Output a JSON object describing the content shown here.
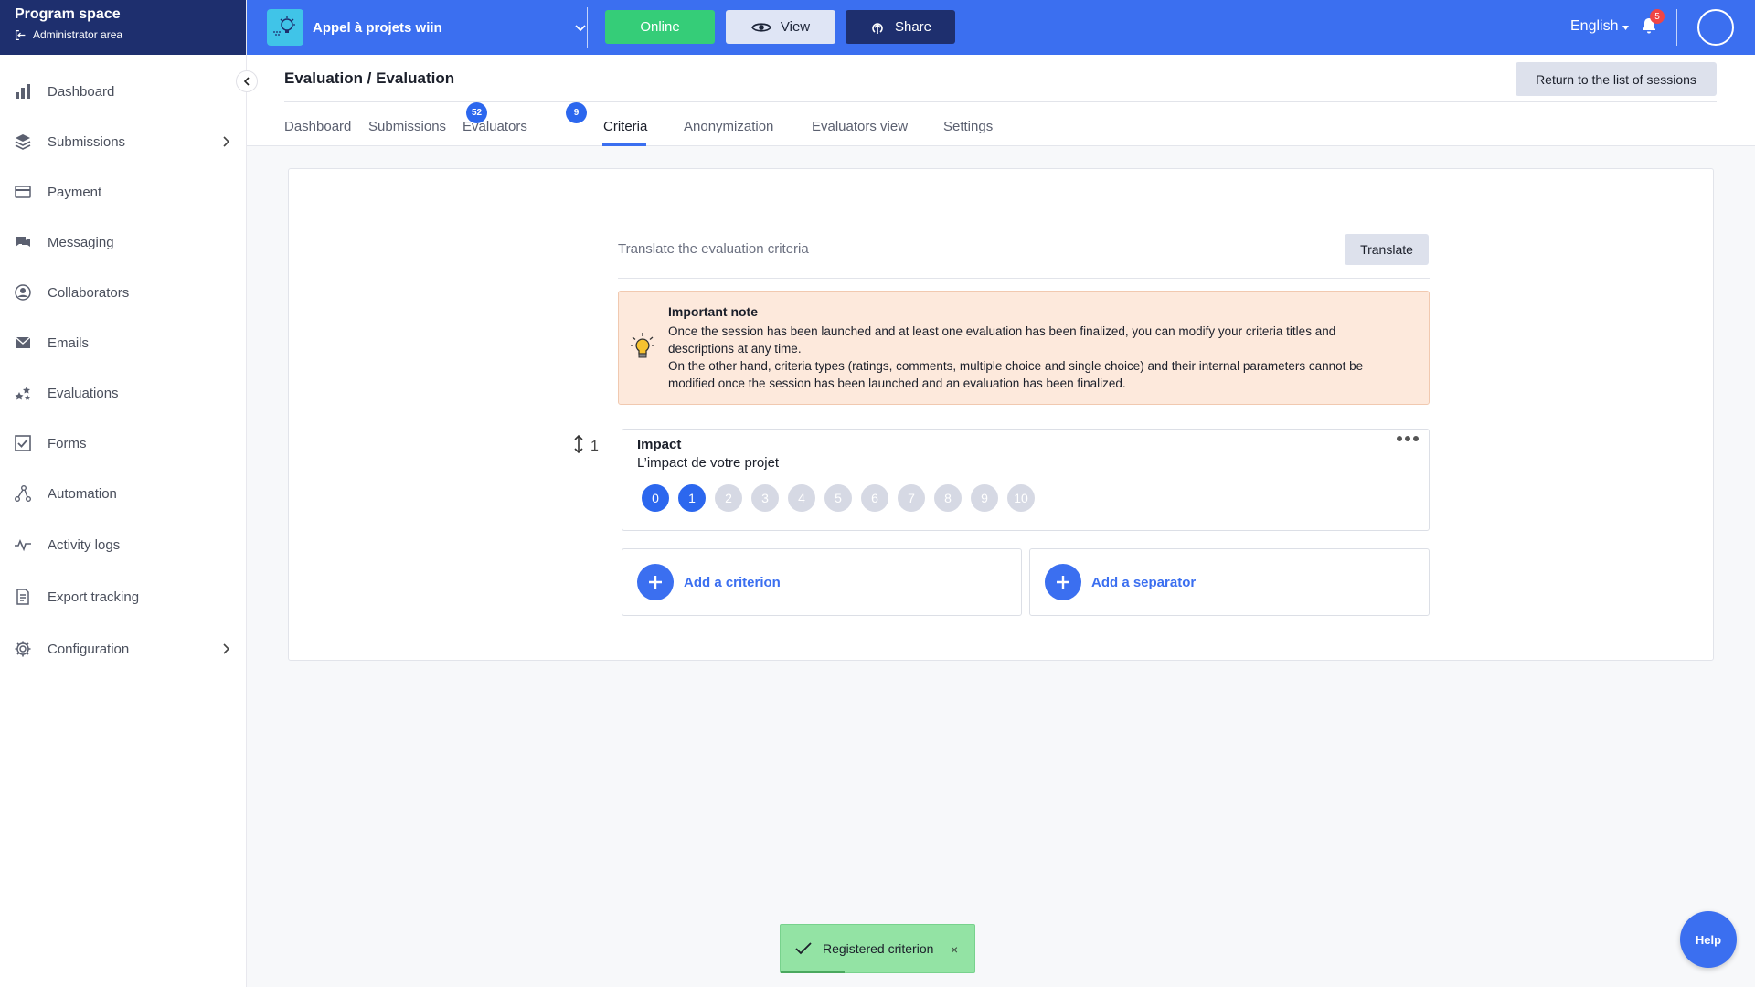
{
  "sidebar": {
    "title": "Program space",
    "admin_link": "Administrator area",
    "items": [
      {
        "label": "Dashboard",
        "icon": "bar-chart-icon"
      },
      {
        "label": "Submissions",
        "icon": "layers-icon"
      },
      {
        "label": "Payment",
        "icon": "credit-card-icon"
      },
      {
        "label": "Messaging",
        "icon": "chat-icon"
      },
      {
        "label": "Collaborators",
        "icon": "user-circle-icon"
      },
      {
        "label": "Emails",
        "icon": "envelope-icon"
      },
      {
        "label": "Evaluations",
        "icon": "stars-icon"
      },
      {
        "label": "Forms",
        "icon": "checkbox-icon"
      },
      {
        "label": "Automation",
        "icon": "flow-icon"
      },
      {
        "label": "Activity logs",
        "icon": "pulse-icon"
      },
      {
        "label": "Export tracking",
        "icon": "document-icon"
      },
      {
        "label": "Configuration",
        "icon": "gear-icon"
      }
    ]
  },
  "topbar": {
    "program_name": "Appel à projets wiin",
    "online_label": "Online",
    "view_label": "View",
    "share_label": "Share",
    "language": "English",
    "notification_count": "5"
  },
  "header": {
    "title": "Evaluation / Evaluation",
    "return_label": "Return to the list of sessions",
    "tabs": [
      {
        "label": "Dashboard"
      },
      {
        "label": "Submissions",
        "badge": "52"
      },
      {
        "label": "Evaluators",
        "badge": "9"
      },
      {
        "label": "Criteria"
      },
      {
        "label": "Anonymization"
      },
      {
        "label": "Evaluators view"
      },
      {
        "label": "Settings"
      }
    ],
    "active_tab": "Criteria"
  },
  "main": {
    "translate_label": "Translate the evaluation criteria",
    "translate_button": "Translate",
    "note": {
      "title": "Important note",
      "paragraph1": "Once the session has been launched and at least one evaluation has been finalized, you can modify your criteria titles and descriptions at any time.",
      "paragraph2": "On the other hand, criteria types (ratings, comments, multiple choice and single choice) and their internal parameters cannot be modified once the session has been launched and an evaluation has been finalized."
    },
    "criterion": {
      "number": "1",
      "title": "Impact",
      "description": "L’impact de votre projet",
      "scale": [
        "0",
        "1",
        "2",
        "3",
        "4",
        "5",
        "6",
        "7",
        "8",
        "9",
        "10"
      ],
      "selected_max": 1
    },
    "add_criterion_label": "Add a criterion",
    "add_separator_label": "Add a separator"
  },
  "toast": {
    "message": "Registered criterion",
    "close": "×"
  },
  "help_label": "Help",
  "colors": {
    "primary": "#3b6ff0",
    "navy": "#1e2f6e",
    "online_green": "#35cd78",
    "note_bg": "#fde9dc",
    "toast_bg": "#93e3a4"
  }
}
